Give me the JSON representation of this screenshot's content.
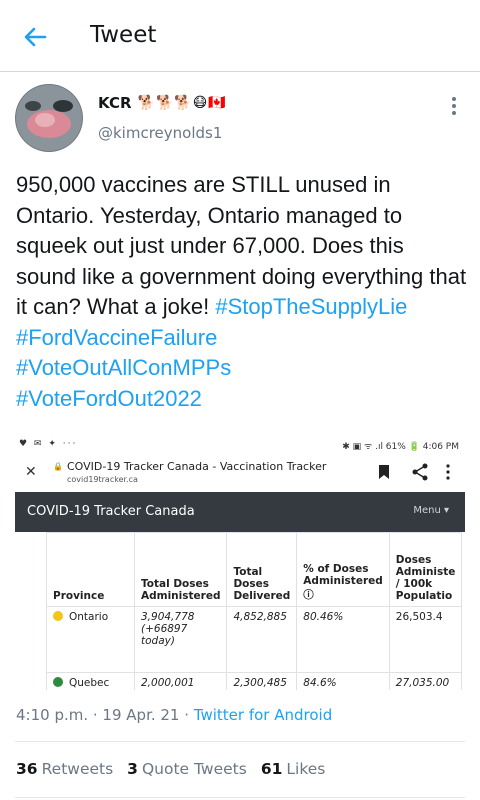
{
  "header": {
    "title": "Tweet"
  },
  "author": {
    "name": "KCR",
    "name_emoji": "🐕🐕🐕😷🇨🇦",
    "handle": "@kimcreynolds1"
  },
  "tweet": {
    "text_line": "950,000 vaccines are STILL unused in Ontario. Yesterday, Ontario managed to squeek out just under 67,000. Does this sound like a government doing everything that it can? What a joke!",
    "hashtag1": "#StopTheSupplyLie",
    "hashtag2": "#FordVaccineFailure",
    "hashtag3": "#VoteOutAllConMPPs",
    "hashtag4": "#VoteFordOut2022"
  },
  "media": {
    "status_left": "♥ ✉ ✦ ···",
    "status_right": "✱ ▣ ᯤ .ıl 61% 🔋 4:06 PM",
    "browser_title": "COVID-19 Tracker Canada - Vaccination Tracker",
    "browser_url": "covid19tracker.ca",
    "nav_brand": "COVID-19 Tracker Canada",
    "nav_menu": "Menu ▾",
    "table": {
      "headers": [
        "Province",
        "Total Doses Administered",
        "Total Doses Delivered",
        "% of Doses Administered ⓘ",
        "Doses Administe / 100k Populatio"
      ],
      "row": [
        "Ontario",
        "3,904,778 (+66897 today)",
        "4,852,885",
        "80.46%",
        "26,503.4"
      ],
      "row2": [
        "Quebec",
        "2,000,001",
        "2,300,485",
        "84.6%",
        "27,035.00"
      ]
    }
  },
  "meta": {
    "time": "4:10 p.m. · 19 Apr. 21 · ",
    "client": "Twitter for Android"
  },
  "stats": {
    "retweets_count": "36",
    "retweets_label": "Retweets",
    "quotes_count": "3",
    "quotes_label": "Quote Tweets",
    "likes_count": "61",
    "likes_label": "Likes"
  },
  "colors": {
    "link": "#1da1f2",
    "secondary": "#6b7785",
    "nav_bg": "#343a40"
  }
}
